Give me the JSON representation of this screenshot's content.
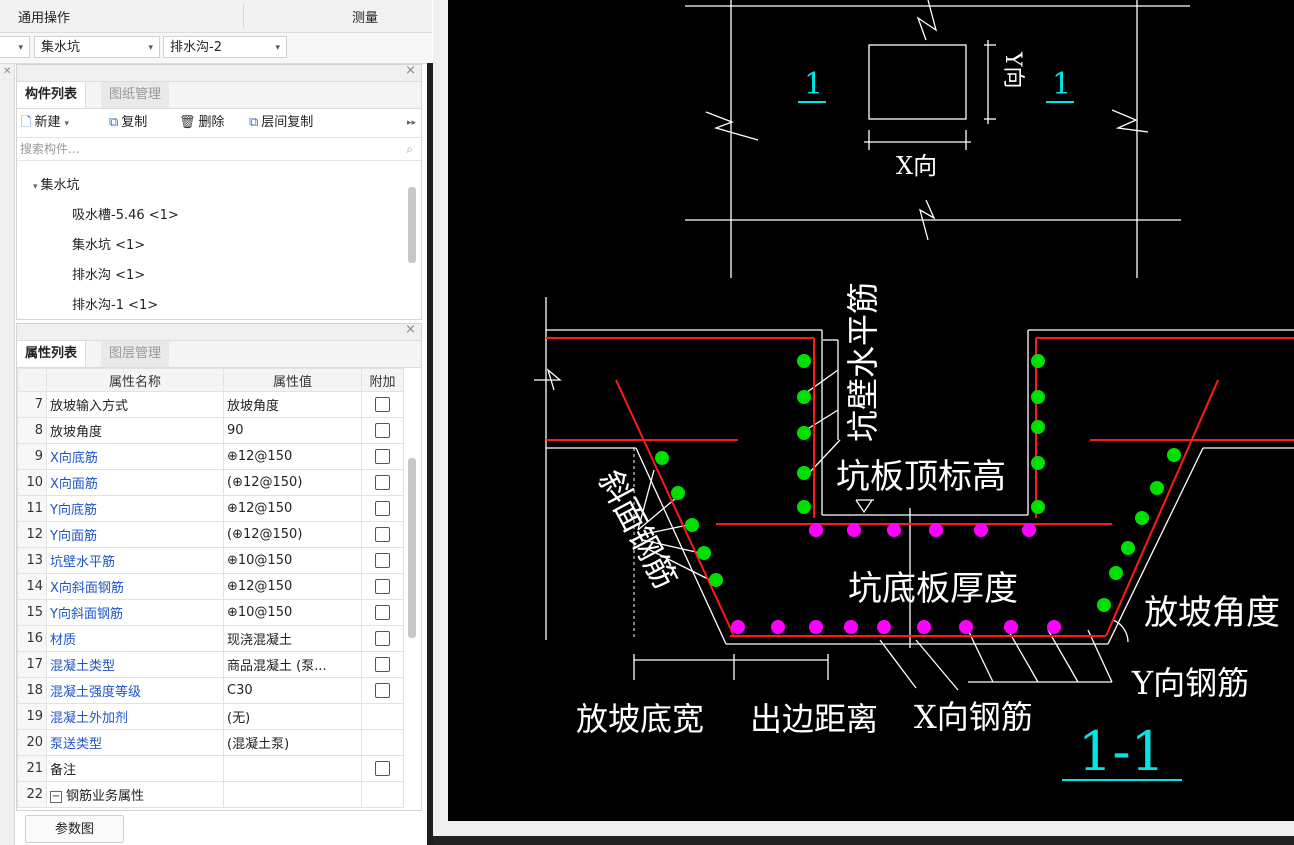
{
  "toolbar_top": {
    "general_ops": "通用操作",
    "measure": "测量"
  },
  "selectors": {
    "combo1_value": "集水坑",
    "combo2_value": "排水沟-2"
  },
  "component_panel": {
    "tab_active": "构件列表",
    "tab_inactive": "图纸管理",
    "buttons": {
      "new": "新建",
      "copy": "复制",
      "delete": "删除",
      "floor_copy": "层间复制"
    },
    "search_placeholder": "搜索构件...",
    "tree": {
      "group": "集水坑",
      "items": [
        "吸水槽-5.46 <1>",
        "集水坑 <1>",
        "排水沟 <1>",
        "排水沟-1 <1>"
      ]
    }
  },
  "property_panel": {
    "tab_active": "属性列表",
    "tab_inactive": "图层管理",
    "headers": {
      "name": "属性名称",
      "value": "属性值",
      "extra": "附加"
    },
    "rows": [
      {
        "n": "7",
        "name": "放坡输入方式",
        "value": "放坡角度",
        "blue": false,
        "cb": true
      },
      {
        "n": "8",
        "name": "放坡角度",
        "value": "90",
        "blue": false,
        "cb": true
      },
      {
        "n": "9",
        "name": "X向底筋",
        "value": "⊕12@150",
        "blue": true,
        "cb": true
      },
      {
        "n": "10",
        "name": "X向面筋",
        "value": "(⊕12@150)",
        "blue": true,
        "cb": true
      },
      {
        "n": "11",
        "name": "Y向底筋",
        "value": "⊕12@150",
        "blue": true,
        "cb": true
      },
      {
        "n": "12",
        "name": "Y向面筋",
        "value": "(⊕12@150)",
        "blue": true,
        "cb": true
      },
      {
        "n": "13",
        "name": "坑壁水平筋",
        "value": "⊕10@150",
        "blue": true,
        "cb": true
      },
      {
        "n": "14",
        "name": "X向斜面钢筋",
        "value": "⊕12@150",
        "blue": true,
        "cb": true
      },
      {
        "n": "15",
        "name": "Y向斜面钢筋",
        "value": "⊕10@150",
        "blue": true,
        "cb": true
      },
      {
        "n": "16",
        "name": "材质",
        "value": "现浇混凝土",
        "blue": true,
        "cb": true
      },
      {
        "n": "17",
        "name": "混凝土类型",
        "value": "商品混凝土 (泵...",
        "blue": true,
        "cb": true
      },
      {
        "n": "18",
        "name": "混凝土强度等级",
        "value": "C30",
        "blue": true,
        "cb": true
      },
      {
        "n": "19",
        "name": "混凝土外加剂",
        "value": "(无)",
        "blue": true,
        "cb": false
      },
      {
        "n": "20",
        "name": "泵送类型",
        "value": "(混凝土泵)",
        "blue": true,
        "cb": false
      },
      {
        "n": "21",
        "name": "备注",
        "value": "",
        "blue": false,
        "cb": true
      },
      {
        "n": "22",
        "name": "钢筋业务属性",
        "value": "",
        "blue": false,
        "cb": false,
        "expand": true
      }
    ],
    "param_button": "参数图"
  },
  "drawing": {
    "plan_label_left": "1",
    "plan_label_right": "1",
    "y_dir": "Y向",
    "x_dir": "X向",
    "wall_horiz_bar": "坑壁水平筋",
    "pit_top_elev": "坑板顶标高",
    "slope_bar": "斜面钢筋",
    "pit_bottom_thickness": "坑底板厚度",
    "slope_angle": "放坡角度",
    "y_bar": "Y向钢筋",
    "slope_bottom_width": "放坡底宽",
    "edge_distance": "出边距离",
    "x_bar": "X向钢筋",
    "section_label": "1-1",
    "colors": {
      "background": "#000000",
      "lines": "#ffffff",
      "rebar_red": "#ff1a1a",
      "green_dots": "#00e000",
      "magenta_dots": "#ff00ff",
      "cyan_label": "#00e5e5"
    }
  }
}
